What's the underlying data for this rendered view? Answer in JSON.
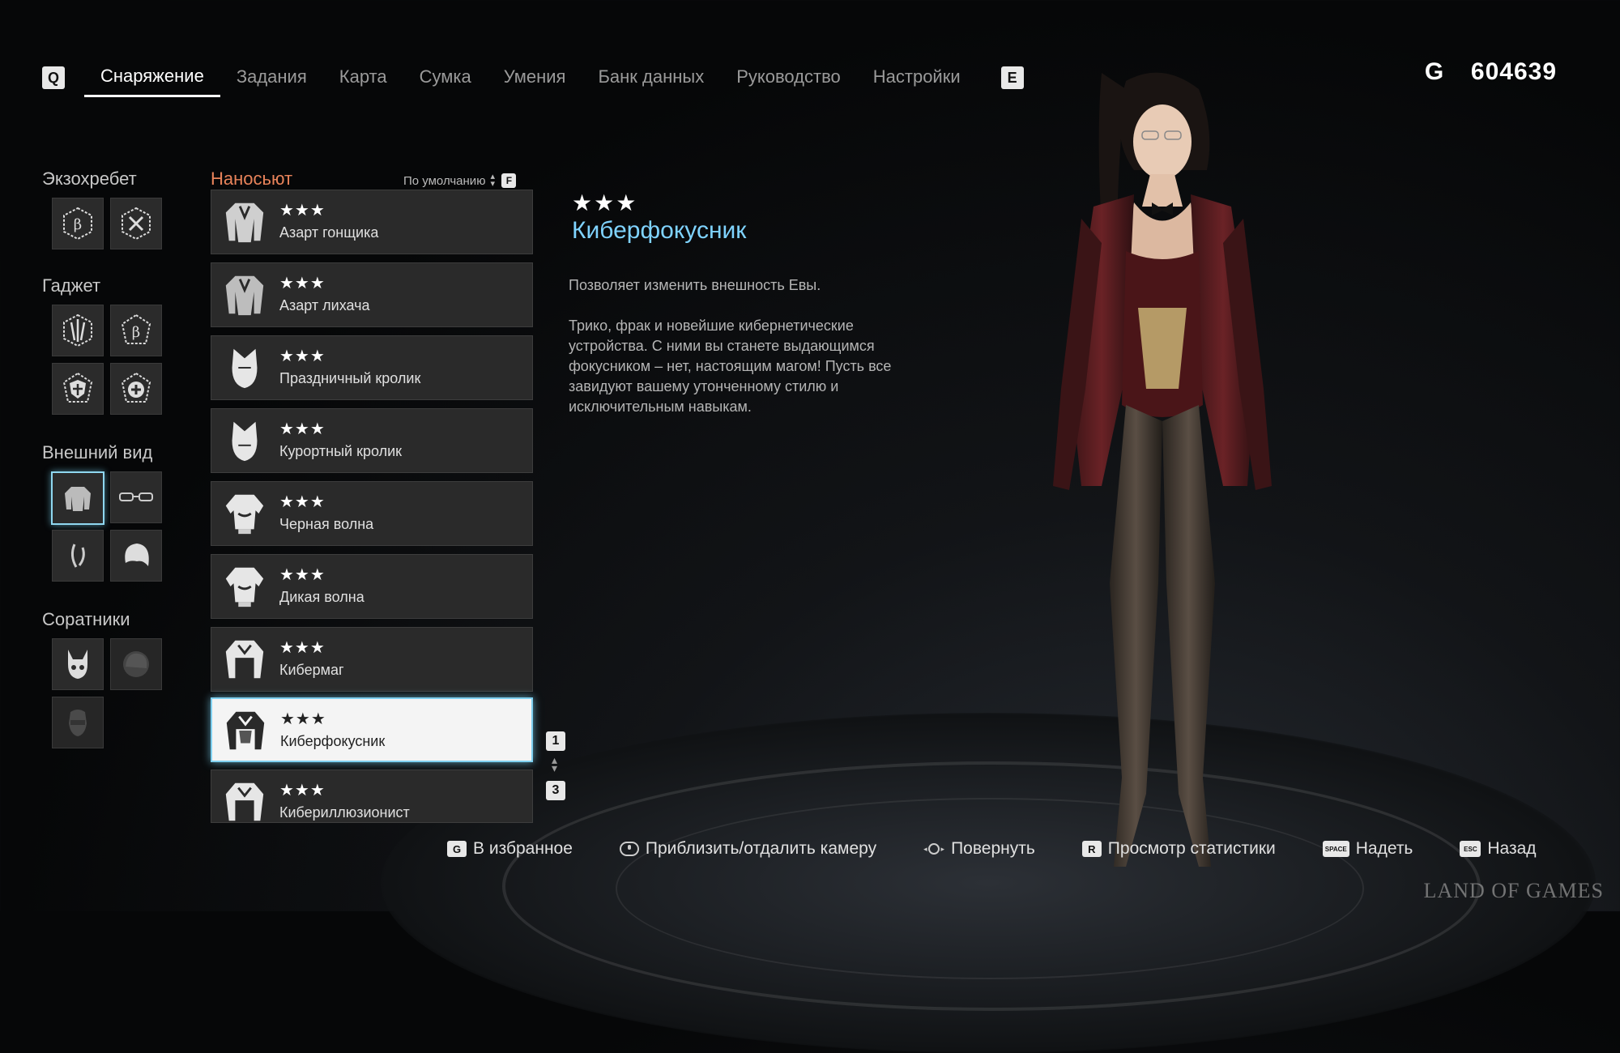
{
  "nav": {
    "left_key": "Q",
    "right_key": "E",
    "tabs": [
      {
        "label": "Снаряжение",
        "active": true
      },
      {
        "label": "Задания"
      },
      {
        "label": "Карта"
      },
      {
        "label": "Сумка"
      },
      {
        "label": "Умения"
      },
      {
        "label": "Банк данных"
      },
      {
        "label": "Руководство"
      },
      {
        "label": "Настройки"
      }
    ]
  },
  "currency": {
    "symbol": "G",
    "amount": "604639"
  },
  "categories": {
    "exospine": "Экзохребет",
    "gadget": "Гаджет",
    "appearance": "Внешний вид",
    "companions": "Соратники"
  },
  "list": {
    "header": "Наносьют",
    "sort_label": "По умолчанию",
    "sort_key": "F",
    "items": [
      {
        "stars": "★★★",
        "name": "Азарт гонщика"
      },
      {
        "stars": "★★★",
        "name": "Азарт лихача"
      },
      {
        "stars": "★★★",
        "name": "Праздничный кролик"
      },
      {
        "stars": "★★★",
        "name": "Курортный кролик"
      },
      {
        "stars": "★★★",
        "name": "Черная волна"
      },
      {
        "stars": "★★★",
        "name": "Дикая волна"
      },
      {
        "stars": "★★★",
        "name": "Кибермаг"
      },
      {
        "stars": "★★★",
        "name": "Киберфокусник",
        "selected": true
      },
      {
        "stars": "★★★",
        "name": "Кибериллюзионист"
      }
    ],
    "pager_up_key": "1",
    "pager_down_key": "3"
  },
  "detail": {
    "stars": "★★★",
    "title": "Киберфокусник",
    "description": "Позволяет изменить внешность Евы.\n\nТрико, фрак и новейшие кибернетические\nустройства. С ними вы станете выдающимся\nфокусником – нет, настоящим магом! Пусть все\nзавидуют вашему утонченному стилю и\nисключительным навыкам."
  },
  "hints": [
    {
      "key": "G",
      "label": "В избранное"
    },
    {
      "key": "",
      "label": "Приблизить/отдалить камеру"
    },
    {
      "key": "",
      "label": "Повернуть"
    },
    {
      "key": "R",
      "label": "Просмотр статистики"
    },
    {
      "key": "SPACE",
      "label": "Надеть"
    },
    {
      "key": "ESC",
      "label": "Назад"
    }
  ],
  "watermark": "LAND OF GAMES",
  "colors": {
    "accent": "#7fd3ff",
    "list_header": "#e8835a",
    "selection_border": "#7fd0f0"
  }
}
